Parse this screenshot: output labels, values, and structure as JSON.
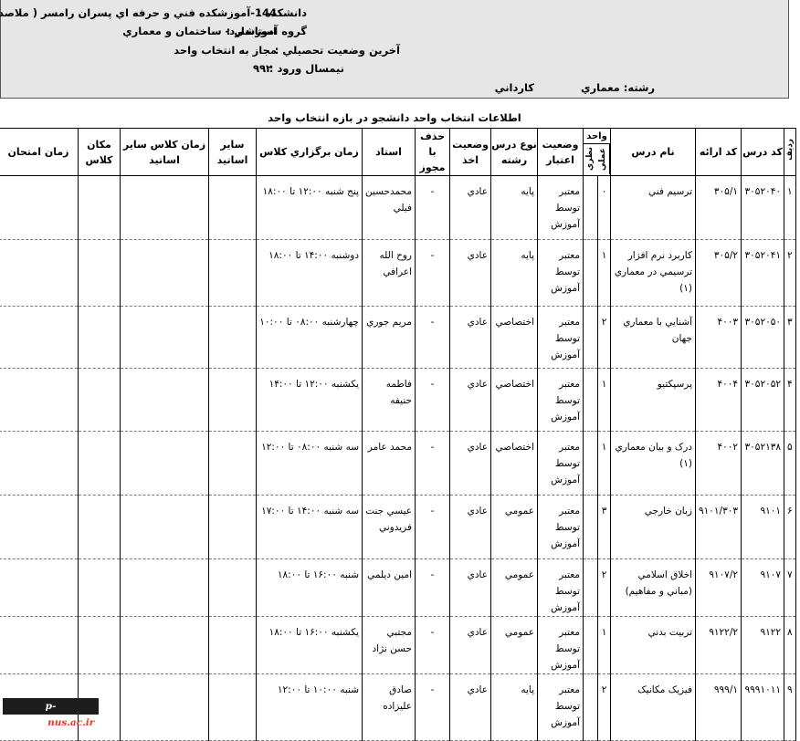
{
  "header": {
    "university_label": "دانشکده :",
    "university_value": "144-آموزشکده فني و حرفه اي پسران رامسر ( ملاصدرا)",
    "group_label": "گروه آموزشي :",
    "group_value": "استاندارد- ساختمان و معماري",
    "status_label": "آخرين وضعيت تحصيلي :",
    "status_value": "مجاز به انتخاب واحد",
    "term_label": "نيمسال ورود :",
    "term_value": "۹۹۲",
    "major": "رشته: معماري",
    "degree": "کارداني"
  },
  "title": "اطلاعات انتخاب واحد دانشجو در بازه انتخاب واحد",
  "columns": {
    "row": "رديف",
    "code": "کد درس",
    "offer": "کد ارائه",
    "name": "نام درس",
    "units": "واحد",
    "theory": "نظري",
    "practical": "عملي",
    "validity": "وضعيت اعتبار",
    "type": "نوع درس رشته",
    "take": "وضعيت اخذ",
    "drop": "حذف با مجوز",
    "teacher": "استاد",
    "time": "زمان برگزاري کلاس",
    "other_teachers": "ساير اساتيد",
    "other_time": "زمان کلاس ساير اساتيد",
    "place": "مکان کلاس",
    "exam": "زمان امتحان"
  },
  "rows": [
    {
      "idx": "۱",
      "code": "۳۰۵۲۰۴۰",
      "offer": "۳۰۵/۱",
      "name": "ترسيم فني",
      "theory": "۰",
      "practical": "",
      "validity": "معتبر توسط آموزش",
      "type": "پايه",
      "take": "عادي",
      "drop": "-",
      "teacher": "محمدحسين فيلي",
      "time": "پنج شنبه ۱۲:۰۰ تا ۱۸:۰۰"
    },
    {
      "idx": "۲",
      "code": "۳۰۵۲۰۴۱",
      "offer": "۳۰۵/۲",
      "name": "کاربرد نرم افزار ترسيمي در معماري (۱)",
      "theory": "۱",
      "practical": "",
      "validity": "معتبر توسط آموزش",
      "type": "پايه",
      "take": "عادي",
      "drop": "-",
      "teacher": "روح الله اعرافي",
      "time": "دوشنبه ۱۴:۰۰ تا ۱۸:۰۰"
    },
    {
      "idx": "۳",
      "code": "۳۰۵۲۰۵۰",
      "offer": "۴۰۰۳",
      "name": "آشنايي با معماري جهان",
      "theory": "۲",
      "practical": "",
      "validity": "معتبر توسط آموزش",
      "type": "اختصاصي",
      "take": "عادي",
      "drop": "-",
      "teacher": "مريم جوري",
      "time": "چهارشنبه ۰۸:۰۰ تا ۱۰:۰۰"
    },
    {
      "idx": "۴",
      "code": "۳۰۵۲۰۵۲",
      "offer": "۴۰۰۴",
      "name": "پرسپکتيو",
      "theory": "۱",
      "practical": "",
      "validity": "معتبر توسط آموزش",
      "type": "اختصاصي",
      "take": "عادي",
      "drop": "-",
      "teacher": "فاطمه حنيفه",
      "time": "يکشنبه ۱۲:۰۰ تا ۱۴:۰۰"
    },
    {
      "idx": "۵",
      "code": "۳۰۵۲۱۳۸",
      "offer": "۴۰۰۲",
      "name": "درک و بيان معماري (۱)",
      "theory": "۱",
      "practical": "",
      "validity": "معتبر توسط آموزش",
      "type": "اختصاصي",
      "take": "عادي",
      "drop": "-",
      "teacher": "محمد عامر",
      "time": "سه شنبه ۰۸:۰۰ تا ۱۲:۰۰"
    },
    {
      "idx": "۶",
      "code": "۹۱۰۱",
      "offer": "۹۱۰۱/۳۰۳",
      "name": "زبان خارجي",
      "theory": "۳",
      "practical": "",
      "validity": "معتبر توسط آموزش",
      "type": "عمومي",
      "take": "عادي",
      "drop": "-",
      "teacher": "عيسي جنت فريدوني",
      "time": "سه شنبه ۱۴:۰۰ تا ۱۷:۰۰"
    },
    {
      "idx": "۷",
      "code": "۹۱۰۷",
      "offer": "۹۱۰۷/۲",
      "name": "اخلاق اسلامي (مباني و مفاهيم)",
      "theory": "۲",
      "practical": "",
      "validity": "معتبر توسط آموزش",
      "type": "عمومي",
      "take": "عادي",
      "drop": "-",
      "teacher": "امين ديلمي",
      "time": "شنبه ۱۶:۰۰ تا ۱۸:۰۰"
    },
    {
      "idx": "۸",
      "code": "۹۱۲۲",
      "offer": "۹۱۲۲/۲",
      "name": "تربيت بدني",
      "theory": "۱",
      "practical": "",
      "validity": "معتبر توسط آموزش",
      "type": "عمومي",
      "take": "عادي",
      "drop": "-",
      "teacher": "مجتبي حسن نژاد",
      "time": "يکشنبه ۱۶:۰۰ تا ۱۸:۰۰"
    },
    {
      "idx": "۹",
      "code": "۹۹۹۱۰۱۱",
      "offer": "۹۹۹/۱",
      "name": "فيزيک مکانيک",
      "theory": "۲",
      "practical": "",
      "validity": "معتبر توسط آموزش",
      "type": "پايه",
      "take": "عادي",
      "drop": "-",
      "teacher": "صادق عليزاده",
      "time": "شنبه ۱۰:۰۰ تا ۱۲:۰۰"
    }
  ],
  "logo": {
    "prefix": "p-ramsar.",
    "suffix": "nus.ac.ir"
  }
}
